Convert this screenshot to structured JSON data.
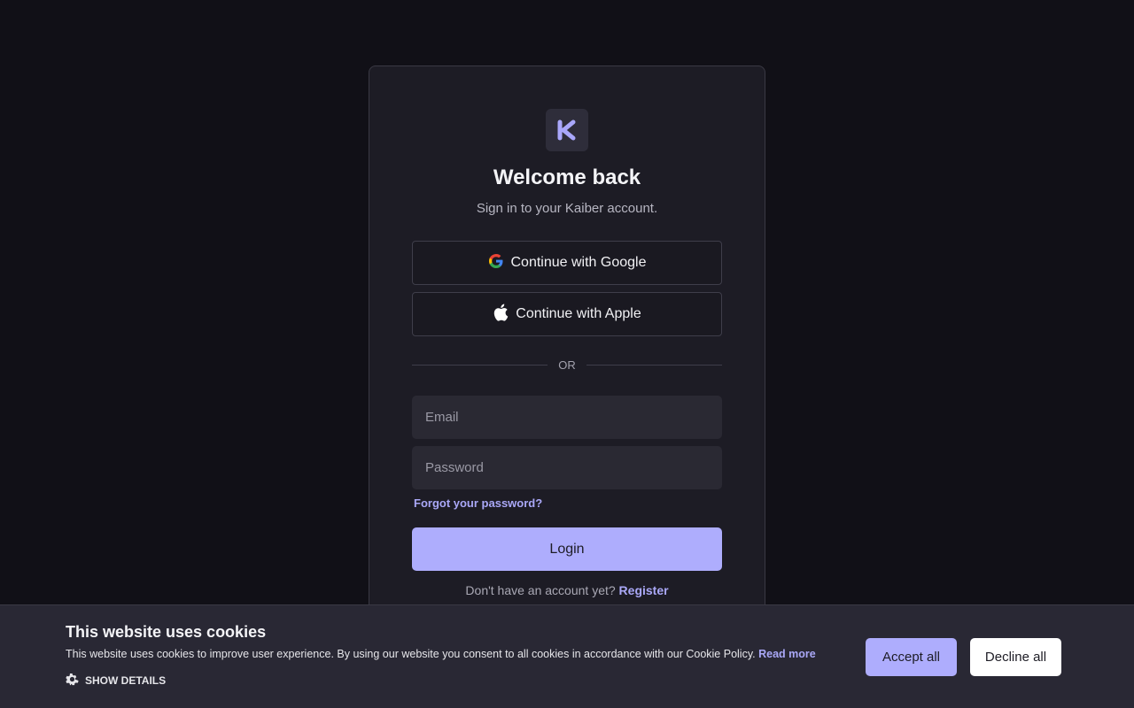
{
  "login": {
    "title": "Welcome back",
    "subtitle": "Sign in to your Kaiber account.",
    "google_label": "Continue with Google",
    "apple_label": "Continue with Apple",
    "divider_text": "OR",
    "email_placeholder": "Email",
    "password_placeholder": "Password",
    "forgot_label": "Forgot your password?",
    "login_label": "Login",
    "register_prompt": "Don't have an account yet?",
    "register_label": "Register"
  },
  "cookie": {
    "title": "This website uses cookies",
    "text": "This website uses cookies to improve user experience. By using our website you consent to all cookies in accordance with our Cookie Policy.",
    "read_more": "Read more",
    "show_details": "SHOW DETAILS",
    "accept_label": "Accept all",
    "decline_label": "Decline all"
  },
  "icons": {
    "logo": "kaiber-logo-icon",
    "google": "google-icon",
    "apple": "apple-icon",
    "gear": "gear-icon"
  },
  "colors": {
    "background": "#111017",
    "card": "#1d1c25",
    "accent": "#aeadfd",
    "link": "#aaa8f7",
    "cookie_bar": "#292834"
  }
}
